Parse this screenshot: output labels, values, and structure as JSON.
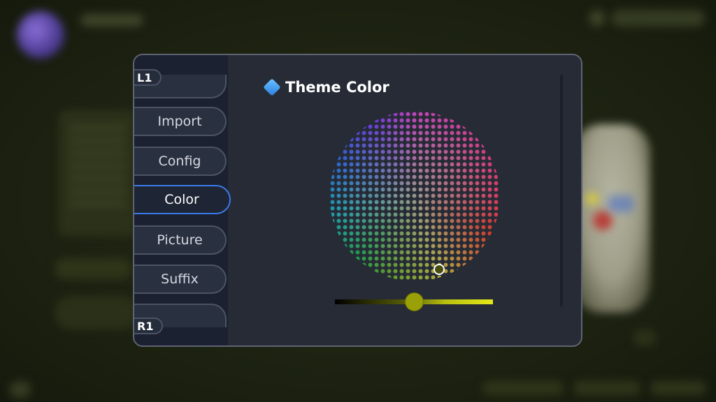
{
  "background": {
    "avatar_icon": "avatar-icon",
    "controller_icon": "gamepad-icon"
  },
  "dialog": {
    "shoulder_left": "L1",
    "shoulder_right": "R1",
    "menu": [
      {
        "id": "import",
        "label": "Import",
        "active": false
      },
      {
        "id": "config",
        "label": "Config",
        "active": false
      },
      {
        "id": "color",
        "label": "Color",
        "active": true
      },
      {
        "id": "picture",
        "label": "Picture",
        "active": false
      },
      {
        "id": "suffix",
        "label": "Suffix",
        "active": false
      }
    ],
    "section_icon": "diamond-icon",
    "section_title": "Theme Color",
    "color_wheel": {
      "selected_color": "#4a4d10"
    },
    "brightness_slider": {
      "value_fraction": 0.5,
      "track_color": "#e4e81a"
    },
    "accent_color": "#3b7be8"
  }
}
